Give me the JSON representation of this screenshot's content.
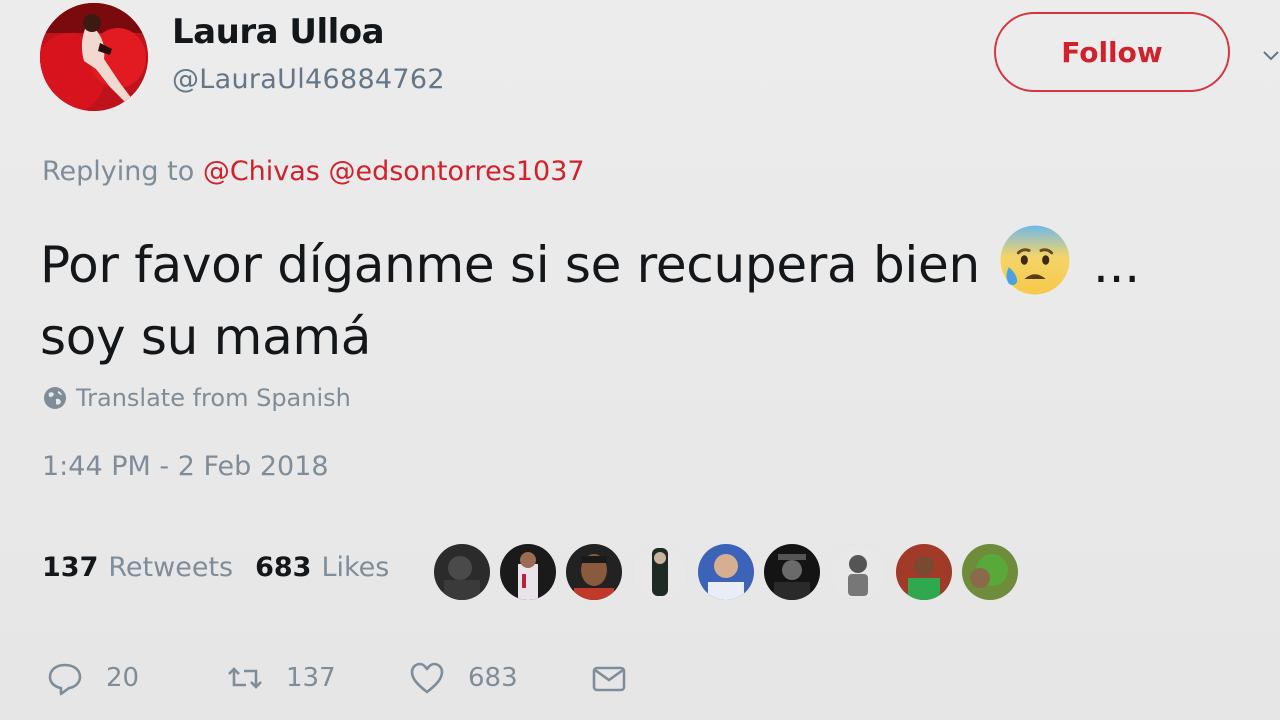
{
  "user": {
    "display_name": "Laura Ulloa",
    "handle": "@LauraUl46884762",
    "avatar_icon": "profile-photo"
  },
  "follow_button": {
    "label": "Follow",
    "color": "#d0222c"
  },
  "reply": {
    "prefix": "Replying to",
    "mentions": [
      "@Chivas",
      "@edsontorres1037"
    ]
  },
  "tweet": {
    "line1": "Por favor díganme si se recupera bien",
    "emoji": "anxious-face-with-sweat",
    "line1_suffix": "...",
    "line2": "soy su mamá"
  },
  "translate": {
    "label": "Translate from Spanish",
    "icon": "globe-icon"
  },
  "timestamp": "1:44 PM - 2 Feb 2018",
  "stats": {
    "retweets": {
      "count": "137",
      "label": "Retweets"
    },
    "likes": {
      "count": "683",
      "label": "Likes"
    }
  },
  "likers_count_shown": 9,
  "actions": {
    "reply_count": "20",
    "retweet_count": "137",
    "like_count": "683"
  },
  "colors": {
    "accent": "#d0222c",
    "muted": "#7f8d99",
    "text": "#14171a",
    "background": "#e8e8e8"
  }
}
